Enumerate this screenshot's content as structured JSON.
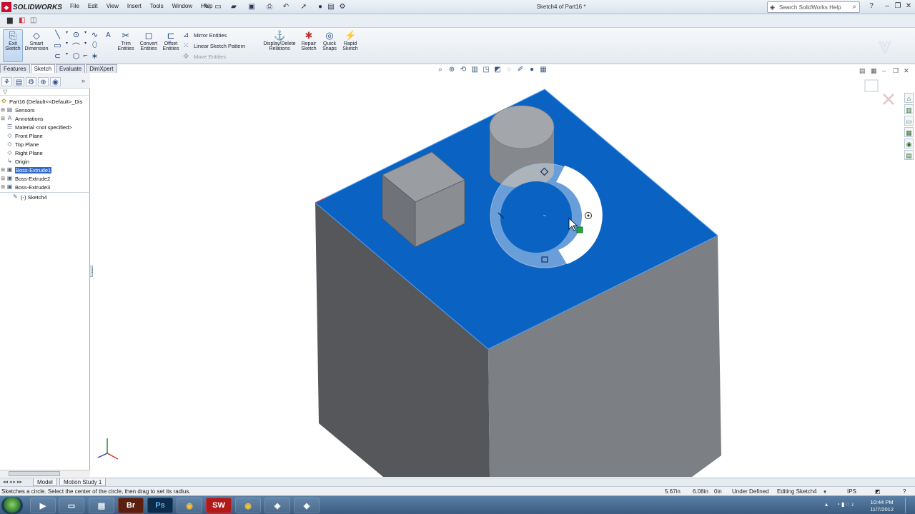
{
  "app": {
    "name": "SOLIDWORKS",
    "doc_title": "Sketch4 of Part16 *"
  },
  "menu": [
    "File",
    "Edit",
    "View",
    "Insert",
    "Tools",
    "Window",
    "Help"
  ],
  "help_search": {
    "placeholder": "Search SolidWorks Help"
  },
  "ribbon": {
    "exit_sketch": "Exit Sketch",
    "smart_dimension": "Smart Dimension",
    "trim_entities": "Trim Entities",
    "convert_entities": "Convert Entities",
    "offset_entities": "Offset Entities",
    "mirror_entities": "Mirror Entities",
    "linear_sketch_pattern": "Linear Sketch Pattern",
    "move_entities": "Move Entities",
    "display_delete_relations": "Display/Delete Relations",
    "repair_sketch": "Repair Sketch",
    "quick_snaps": "Quick Snaps",
    "rapid_sketch": "Rapid Sketch"
  },
  "command_tabs": [
    "Features",
    "Sketch",
    "Evaluate",
    "DimXpert"
  ],
  "active_tab": "Sketch",
  "tree": {
    "root": "Part16  (Default<<Default>_Dis",
    "items": [
      {
        "label": "Sensors",
        "icon": "folder-icon"
      },
      {
        "label": "Annotations",
        "icon": "annotation-icon"
      },
      {
        "label": "Material <not specified>",
        "icon": "material-icon"
      },
      {
        "label": "Front Plane",
        "icon": "plane-icon"
      },
      {
        "label": "Top Plane",
        "icon": "plane-icon"
      },
      {
        "label": "Right Plane",
        "icon": "plane-icon"
      },
      {
        "label": "Origin",
        "icon": "origin-icon"
      },
      {
        "label": "Boss-Extrude1",
        "icon": "extrude-icon",
        "selected": true
      },
      {
        "label": "Boss-Extrude2",
        "icon": "extrude-icon"
      },
      {
        "label": "Boss-Extrude3",
        "icon": "extrude-icon"
      },
      {
        "label": "(-) Sketch4",
        "icon": "sketch-icon"
      }
    ]
  },
  "bottom_tabs": [
    "Model",
    "Motion Study 1"
  ],
  "status": {
    "message": "Sketches a circle. Select the center of the circle, then drag to set its radius.",
    "x": "5.67in",
    "y": "6.08in",
    "z": "0in",
    "definition": "Under Defined",
    "editing": "Editing Sketch4",
    "units": "IPS"
  },
  "clock": {
    "time": "10:44 PM",
    "date": "11/7/2012"
  },
  "taskbar_apps": [
    "Br",
    "Ps"
  ],
  "colors": {
    "face_blue": "#0a62c2",
    "body_dark": "#55575b",
    "body_light": "#7c7f84"
  }
}
